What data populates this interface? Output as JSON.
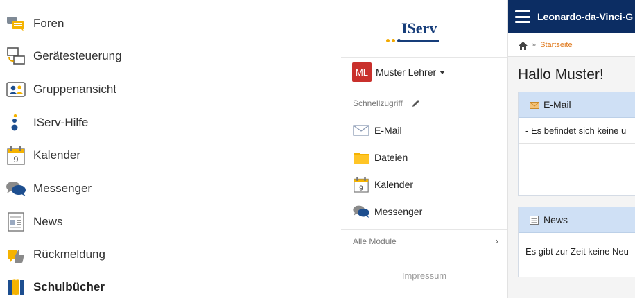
{
  "left_modules": [
    {
      "name": "forum-icon",
      "label": "Foren"
    },
    {
      "name": "device-control-icon",
      "label": "Gerätesteuerung"
    },
    {
      "name": "group-view-icon",
      "label": "Gruppenansicht"
    },
    {
      "name": "help-icon",
      "label": "IServ-Hilfe"
    },
    {
      "name": "calendar-icon",
      "label": "Kalender"
    },
    {
      "name": "messenger-icon",
      "label": "Messenger"
    },
    {
      "name": "news-icon",
      "label": "News"
    },
    {
      "name": "feedback-icon",
      "label": "Rückmeldung"
    },
    {
      "name": "schoolbooks-icon",
      "label": "Schulbücher"
    }
  ],
  "sidebar": {
    "brand": "IServ",
    "user": {
      "initials": "ML",
      "name": "Muster Lehrer"
    },
    "quick_access_title": "Schnellzugriff",
    "quick_items": [
      {
        "icon": "email-icon",
        "label": "E-Mail"
      },
      {
        "icon": "folder-icon",
        "label": "Dateien"
      },
      {
        "icon": "calendar-icon",
        "label": "Kalender"
      },
      {
        "icon": "messenger-icon",
        "label": "Messenger"
      }
    ],
    "all_modules": "Alle Module",
    "all_modules_chevron": "›",
    "impressum": "Impressum"
  },
  "header": {
    "school_name": "Leonardo-da-Vinci-G"
  },
  "breadcrumb": {
    "separator": "»",
    "current": "Startseite"
  },
  "main": {
    "greeting": "Hallo Muster!",
    "email_panel": {
      "title": "E-Mail",
      "body": "- Es befindet sich keine u"
    },
    "news_panel": {
      "title": "News",
      "body": "Es gibt zur Zeit keine Neu"
    }
  },
  "colors": {
    "topbar": "#0c2d63",
    "panel_header": "#cfe0f5",
    "accent_orange": "#e07a1e",
    "avatar": "#c9302c"
  }
}
